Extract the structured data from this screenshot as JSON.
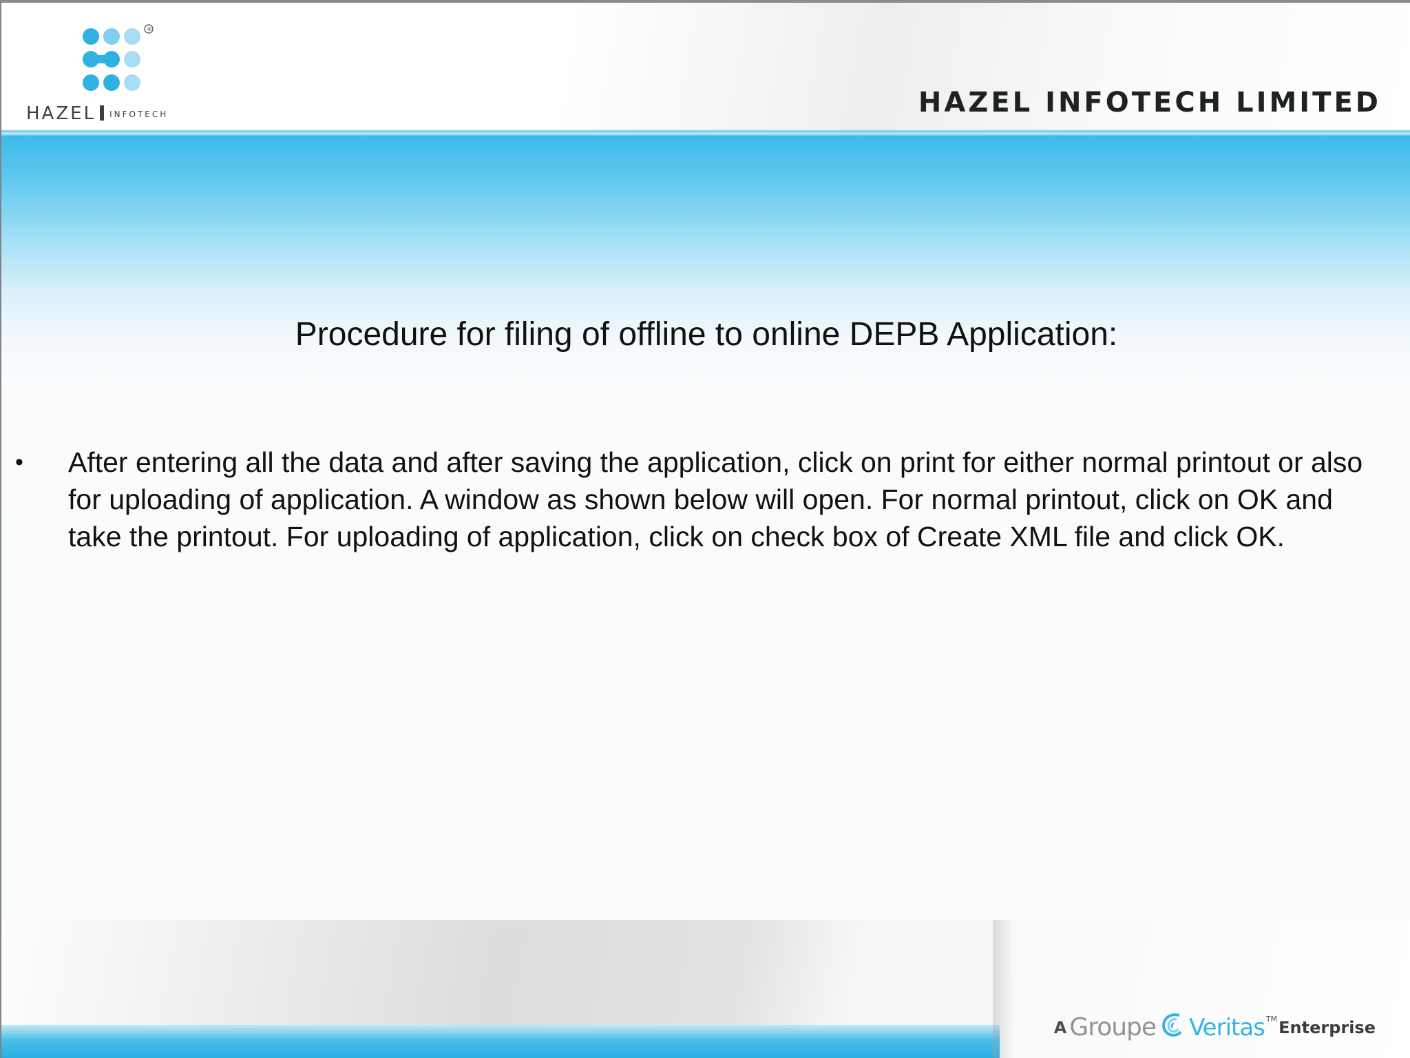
{
  "header": {
    "logo_name": "HAZEL",
    "logo_sub": "INFOTECH",
    "registered_mark": "®",
    "company_name": "HAZEL INFOTECH LIMITED"
  },
  "content": {
    "title": "Procedure for filing of offline to online DEPB Application:",
    "bullets": [
      {
        "mark": "•",
        "text": "After entering all the data and after saving the application, click on print for either normal printout or also for uploading of application. A window as shown below will open. For normal printout, click on OK and take the printout. For uploading of application, click on check box of Create XML file and click OK."
      }
    ]
  },
  "footer": {
    "prefix": "A",
    "groupe": "Groupe",
    "veritas": "Veritas",
    "tm": "TM",
    "suffix": "Enterprise"
  },
  "colors": {
    "accent_blue": "#3bbbeb",
    "logo_blue_dark": "#2fb1e2",
    "logo_blue_light": "#9fdcf3",
    "text": "#111111"
  },
  "icons": {
    "logo": "hazel-dots-logo",
    "footer_mark": "veritas-swirl-icon"
  }
}
